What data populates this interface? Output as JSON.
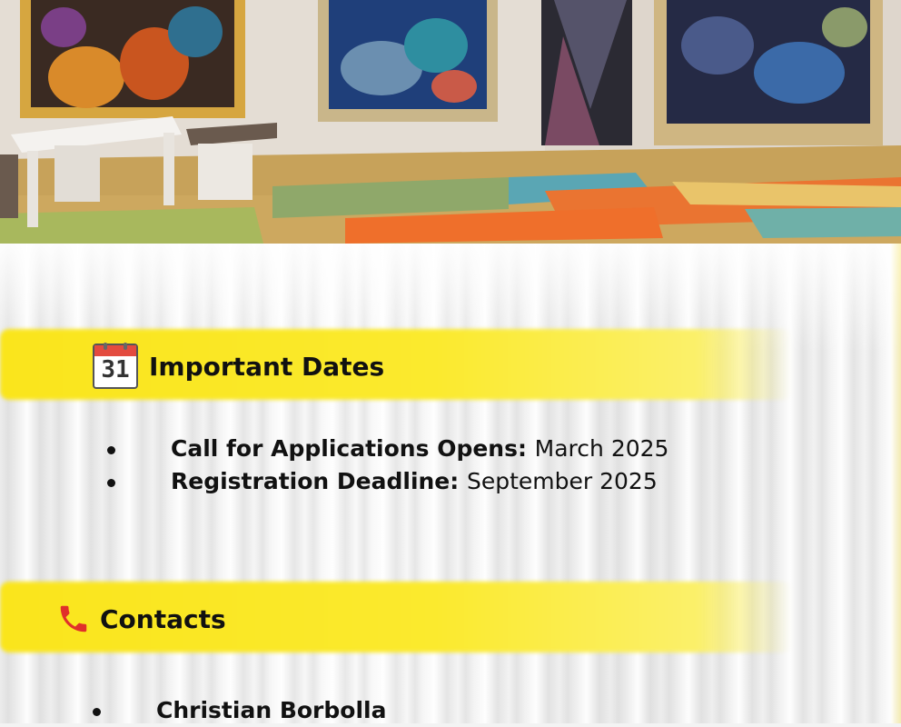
{
  "important_dates": {
    "title": "Important Dates",
    "calendar_day": "31",
    "items": [
      {
        "label": "Call for Applications Opens:",
        "value": "March 2025"
      },
      {
        "label": "Registration Deadline:",
        "value": "September 2025"
      }
    ]
  },
  "contacts": {
    "title": "Contacts",
    "items": [
      {
        "name": "Christian Borbolla"
      }
    ]
  },
  "colors": {
    "band": "#fae51c",
    "text": "#111111",
    "calendar_red": "#e34b3f",
    "phone_red": "#e0302a"
  },
  "icons": [
    "calendar-icon",
    "phone-icon"
  ]
}
